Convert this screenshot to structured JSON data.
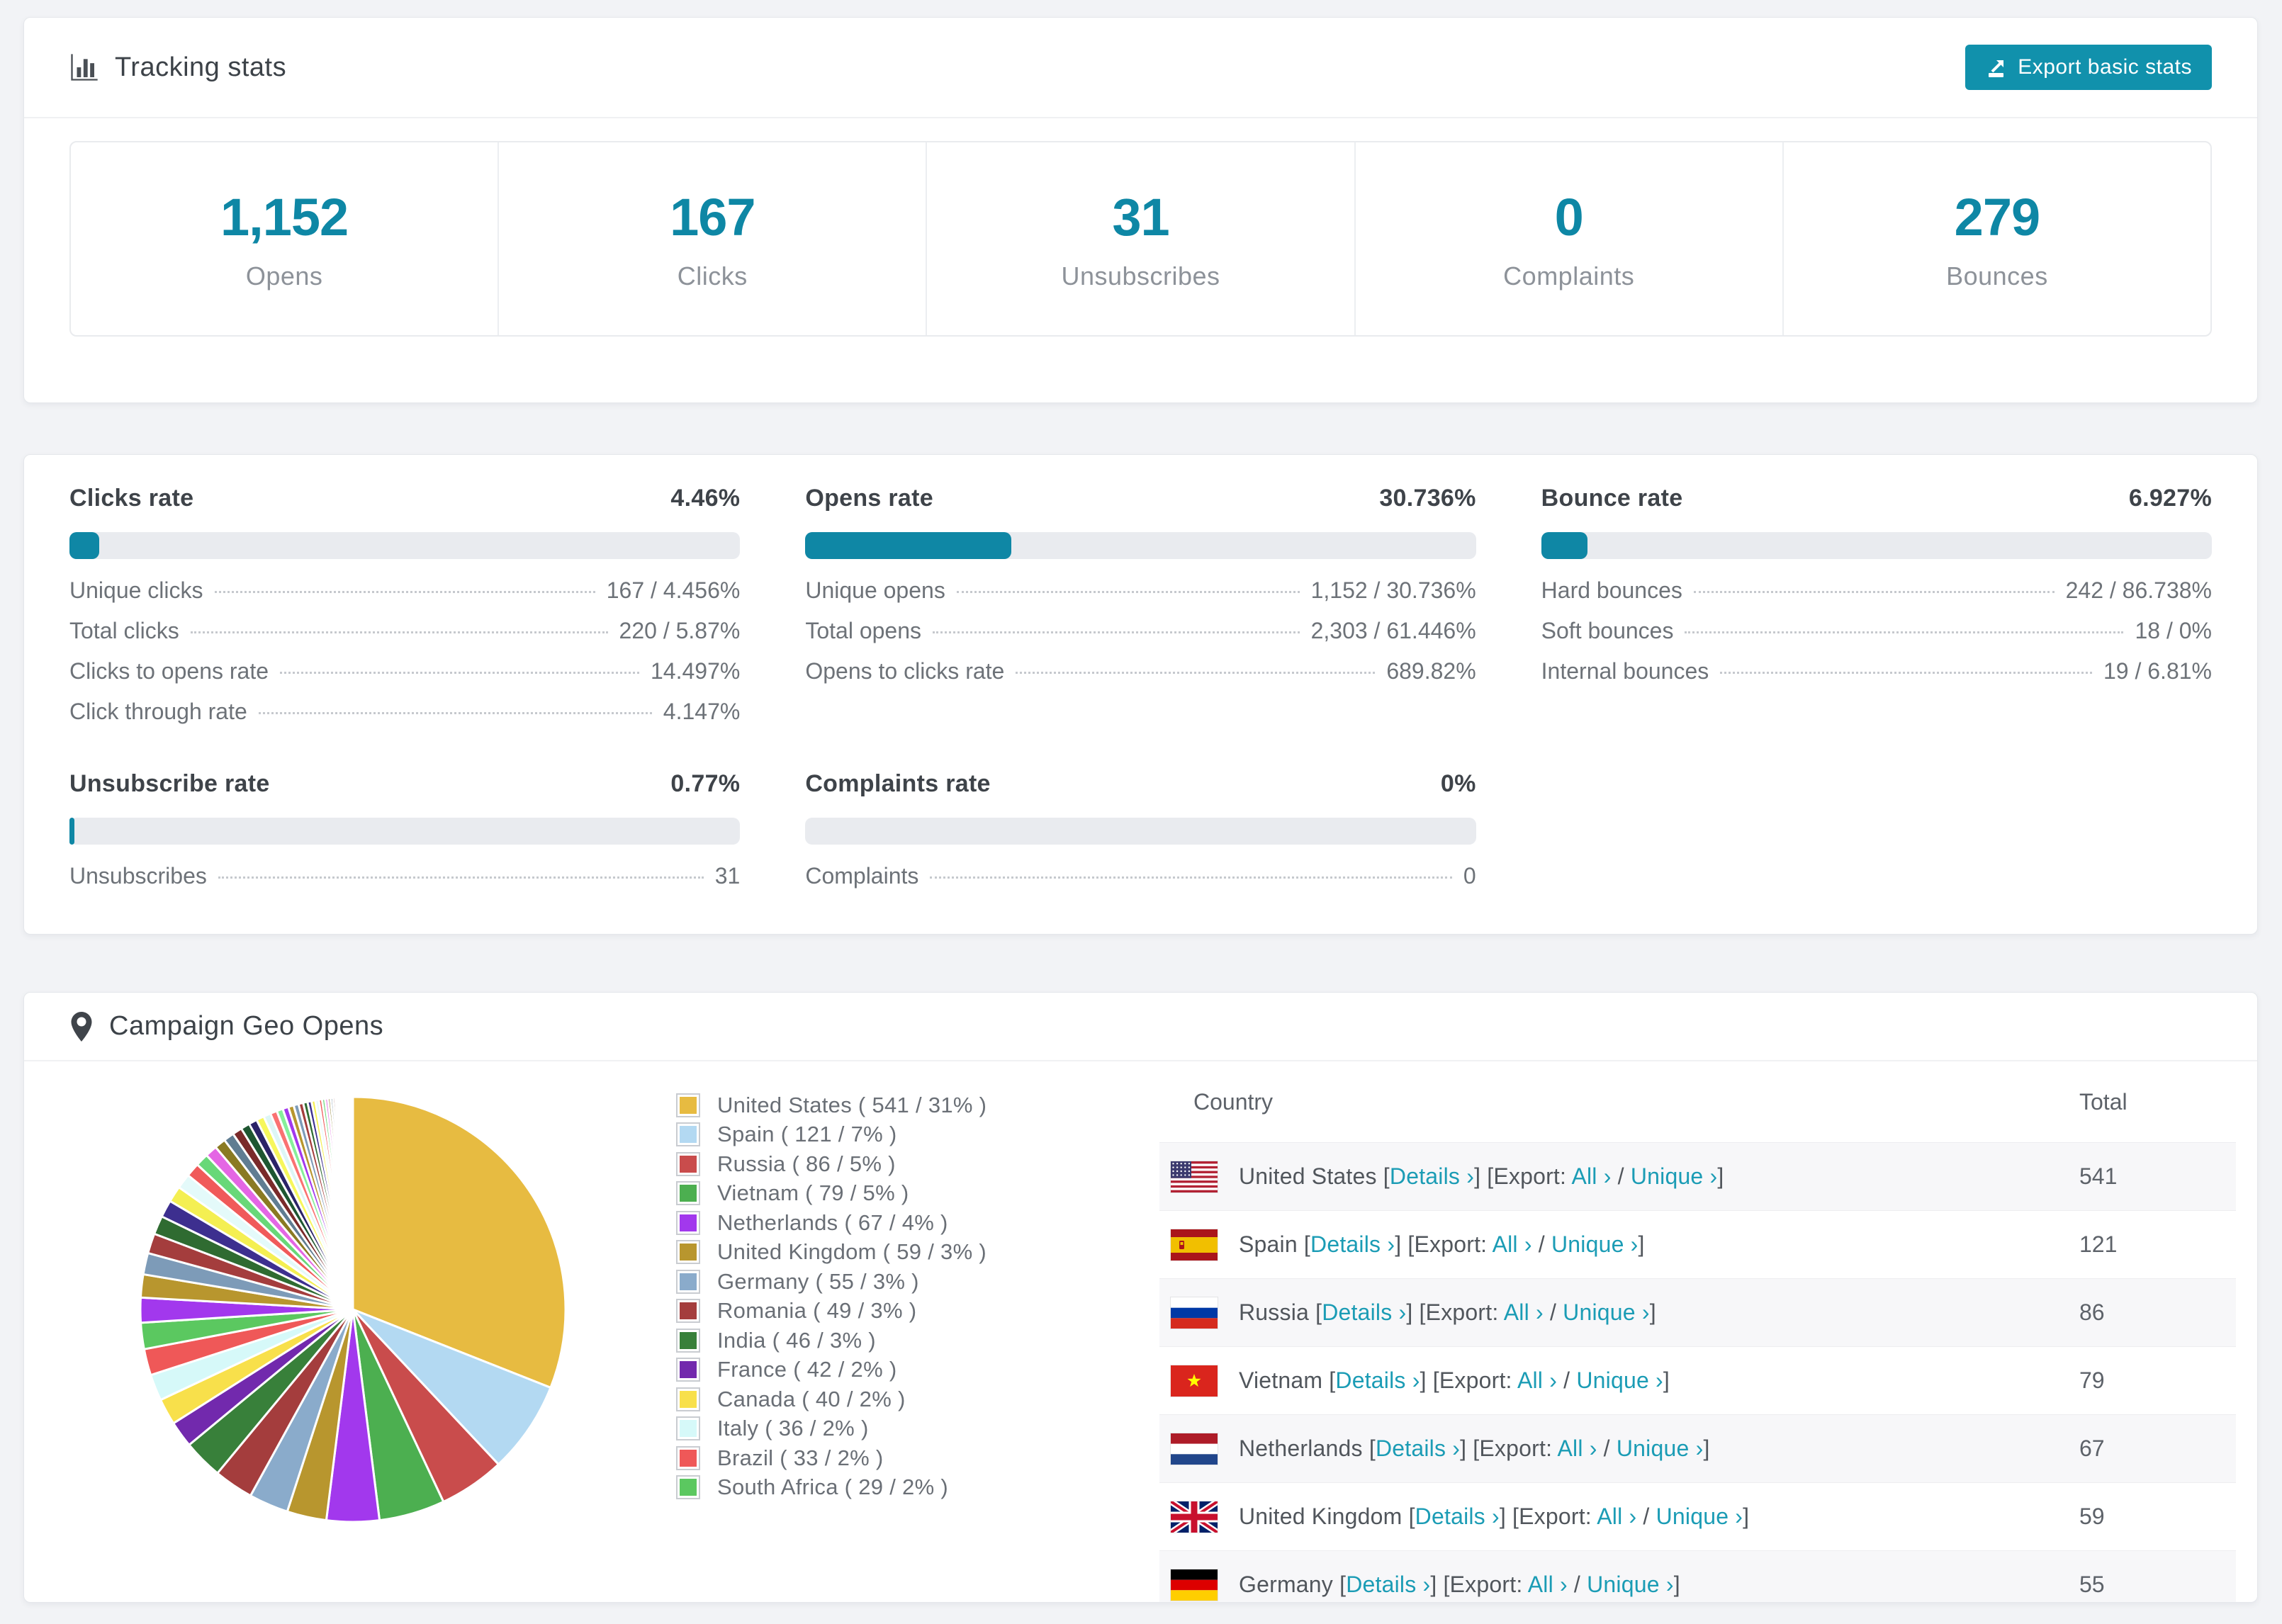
{
  "colors": {
    "accent_teal": "#1191ac",
    "stat_number_teal": "#0e87a5",
    "bar_fill_teal": "#0f87a5",
    "bar_track": "#e9ebef",
    "page_bg": "#f2f3f6"
  },
  "tracking": {
    "title": "Tracking stats",
    "export_button": "Export basic stats",
    "stats": [
      {
        "value": "1,152",
        "label": "Opens"
      },
      {
        "value": "167",
        "label": "Clicks"
      },
      {
        "value": "31",
        "label": "Unsubscribes"
      },
      {
        "value": "0",
        "label": "Complaints"
      },
      {
        "value": "279",
        "label": "Bounces"
      }
    ]
  },
  "rates": {
    "sections": [
      {
        "title": "Clicks rate",
        "value": "4.46%",
        "bar_pct": 4.46,
        "rows": [
          {
            "label": "Unique clicks",
            "value": "167 / 4.456%"
          },
          {
            "label": "Total clicks",
            "value": "220 / 5.87%"
          },
          {
            "label": "Clicks to opens rate",
            "value": "14.497%"
          },
          {
            "label": "Click through rate",
            "value": "4.147%"
          }
        ]
      },
      {
        "title": "Opens rate",
        "value": "30.736%",
        "bar_pct": 30.736,
        "rows": [
          {
            "label": "Unique opens",
            "value": "1,152 / 30.736%"
          },
          {
            "label": "Total opens",
            "value": "2,303 / 61.446%"
          },
          {
            "label": "Opens to clicks rate",
            "value": "689.82%"
          }
        ]
      },
      {
        "title": "Bounce rate",
        "value": "6.927%",
        "bar_pct": 6.927,
        "rows": [
          {
            "label": "Hard bounces",
            "value": "242 / 86.738%"
          },
          {
            "label": "Soft bounces",
            "value": "18 / 0%"
          },
          {
            "label": "Internal bounces",
            "value": "19 / 6.81%"
          }
        ]
      },
      {
        "title": "Unsubscribe rate",
        "value": "0.77%",
        "bar_pct": 0.77,
        "rows": [
          {
            "label": "Unsubscribes",
            "value": "31"
          }
        ]
      },
      {
        "title": "Complaints rate",
        "value": "0%",
        "bar_pct": 0,
        "rows": [
          {
            "label": "Complaints",
            "value": "0"
          }
        ]
      }
    ]
  },
  "geo": {
    "title": "Campaign Geo Opens",
    "table_headers": {
      "country": "Country",
      "total": "Total"
    },
    "link_labels": {
      "details": "Details ›",
      "export_prefix": "Export:",
      "all": "All ›",
      "unique": "Unique ›"
    },
    "rows": [
      {
        "flag": "us",
        "country": "United States",
        "total": "541"
      },
      {
        "flag": "es",
        "country": "Spain",
        "total": "121"
      },
      {
        "flag": "ru",
        "country": "Russia",
        "total": "86"
      },
      {
        "flag": "vn",
        "country": "Vietnam",
        "total": "79"
      },
      {
        "flag": "nl",
        "country": "Netherlands",
        "total": "67"
      },
      {
        "flag": "gb",
        "country": "United Kingdom",
        "total": "59"
      },
      {
        "flag": "de",
        "country": "Germany",
        "total": "55"
      }
    ]
  },
  "chart_data": {
    "type": "pie",
    "title": "Campaign Geo Opens",
    "legend_position": "right",
    "legend_format": "{label} ( {value} / {pct}% )",
    "start_angle_deg": 0,
    "direction": "clockwise",
    "series": [
      {
        "label": "United States",
        "value": 541,
        "pct": 31,
        "color": "#e7bb41"
      },
      {
        "label": "Spain",
        "value": 121,
        "pct": 7,
        "color": "#b3d9f2"
      },
      {
        "label": "Russia",
        "value": 86,
        "pct": 5,
        "color": "#c94c4c"
      },
      {
        "label": "Vietnam",
        "value": 79,
        "pct": 5,
        "color": "#4caf50"
      },
      {
        "label": "Netherlands",
        "value": 67,
        "pct": 4,
        "color": "#a238ed"
      },
      {
        "label": "United Kingdom",
        "value": 59,
        "pct": 3,
        "color": "#b8962e"
      },
      {
        "label": "Germany",
        "value": 55,
        "pct": 3,
        "color": "#8aabcb"
      },
      {
        "label": "Romania",
        "value": 49,
        "pct": 3,
        "color": "#a43d3d"
      },
      {
        "label": "India",
        "value": 46,
        "pct": 3,
        "color": "#38803a"
      },
      {
        "label": "France",
        "value": 42,
        "pct": 2,
        "color": "#7229ad"
      },
      {
        "label": "Canada",
        "value": 40,
        "pct": 2,
        "color": "#f8e04b"
      },
      {
        "label": "Italy",
        "value": 36,
        "pct": 2,
        "color": "#d6f9f9"
      },
      {
        "label": "Brazil",
        "value": 33,
        "pct": 2,
        "color": "#ef5858"
      },
      {
        "label": "South Africa",
        "value": 29,
        "pct": 2,
        "color": "#5bc860"
      }
    ],
    "others": {
      "pct_total": 26,
      "note": "many small unlabeled country slices tapering to hairlines",
      "slice_count": 46,
      "decay": 0.93,
      "palette": [
        "#a238ed",
        "#b8962e",
        "#7d9bb8",
        "#a43d3d",
        "#2f6b31",
        "#3d2f8f",
        "#f4ef52",
        "#e4fafa",
        "#f05a5a",
        "#68d878",
        "#e466e4",
        "#8a7a22",
        "#607d92",
        "#7a2a2a",
        "#1e5631",
        "#2b2367",
        "#f7f75c",
        "#ddf6f6",
        "#fa7272",
        "#86ef9a"
      ]
    }
  }
}
